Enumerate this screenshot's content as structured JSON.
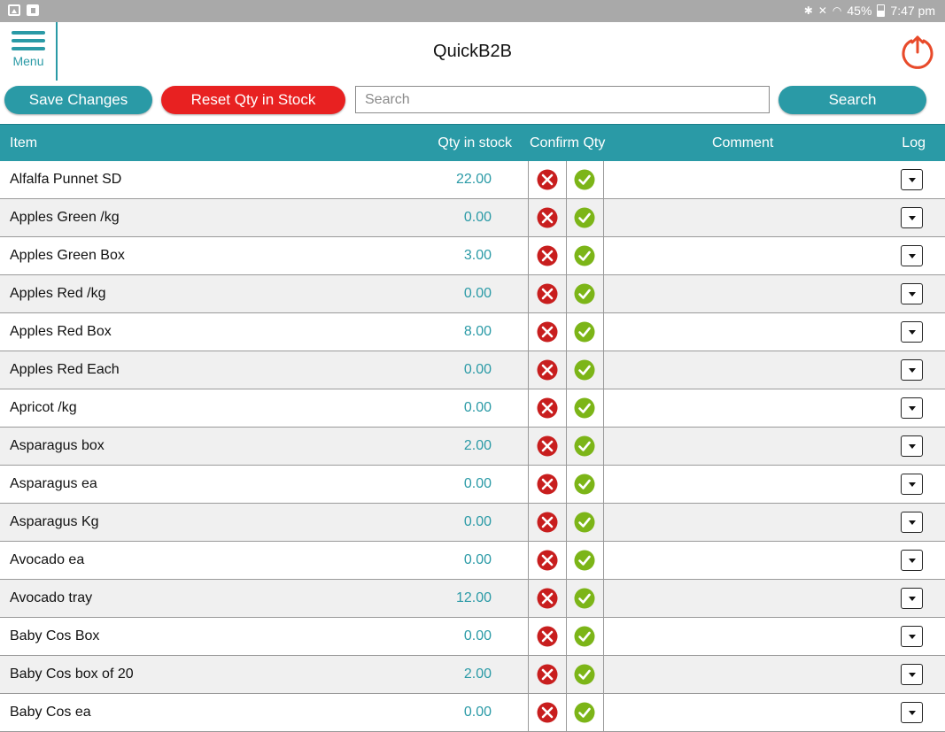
{
  "status_bar": {
    "battery": "45%",
    "time": "7:47 pm"
  },
  "header": {
    "menu_label": "Menu",
    "title": "QuickB2B"
  },
  "toolbar": {
    "save_label": "Save Changes",
    "reset_label": "Reset Qty in Stock",
    "search_placeholder": "Search",
    "search_value": "",
    "search_label": "Search"
  },
  "colors": {
    "accent": "#2a9aa6",
    "reset": "#e82121",
    "reject": "#c81e1e",
    "confirm": "#7cb518"
  },
  "table": {
    "columns": [
      "Item",
      "Qty in stock",
      "Confirm Qty",
      "Comment",
      "Log"
    ],
    "rows": [
      {
        "item": "Alfalfa Punnet SD",
        "qty": "22.00"
      },
      {
        "item": "Apples Green /kg",
        "qty": "0.00"
      },
      {
        "item": "Apples Green Box",
        "qty": "3.00"
      },
      {
        "item": "Apples Red /kg",
        "qty": "0.00"
      },
      {
        "item": "Apples Red Box",
        "qty": "8.00"
      },
      {
        "item": "Apples Red Each",
        "qty": "0.00"
      },
      {
        "item": "Apricot /kg",
        "qty": "0.00"
      },
      {
        "item": "Asparagus box",
        "qty": "2.00"
      },
      {
        "item": "Asparagus ea",
        "qty": "0.00"
      },
      {
        "item": "Asparagus Kg",
        "qty": "0.00"
      },
      {
        "item": "Avocado ea",
        "qty": "0.00"
      },
      {
        "item": "Avocado tray",
        "qty": "12.00"
      },
      {
        "item": "Baby Cos Box",
        "qty": "0.00"
      },
      {
        "item": "Baby Cos box of 20",
        "qty": "2.00"
      },
      {
        "item": "Baby Cos ea",
        "qty": "0.00"
      }
    ]
  }
}
